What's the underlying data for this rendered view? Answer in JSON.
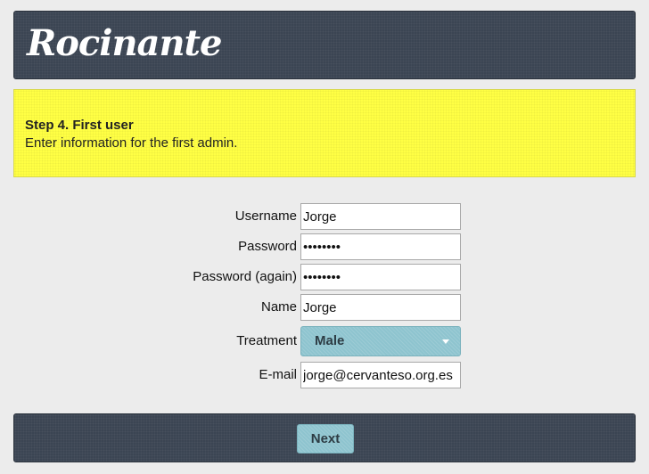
{
  "header": {
    "logo_text": "Rocinante"
  },
  "notice": {
    "title": "Step 4. First user",
    "description": "Enter information for the first admin."
  },
  "form": {
    "username": {
      "label": "Username",
      "value": "Jorge"
    },
    "password": {
      "label": "Password",
      "value": "password"
    },
    "password_again": {
      "label": "Password (again)",
      "value": "password"
    },
    "name": {
      "label": "Name",
      "value": "Jorge"
    },
    "treatment": {
      "label": "Treatment",
      "value": "Male"
    },
    "email": {
      "label": "E-mail",
      "value": "jorge@cervanteso.org.es"
    }
  },
  "footer": {
    "next_label": "Next"
  },
  "colors": {
    "header_bg": "#3b4553",
    "notice_bg": "#ffff44",
    "button_bg": "#8ec4cf",
    "page_bg": "#ececec"
  }
}
